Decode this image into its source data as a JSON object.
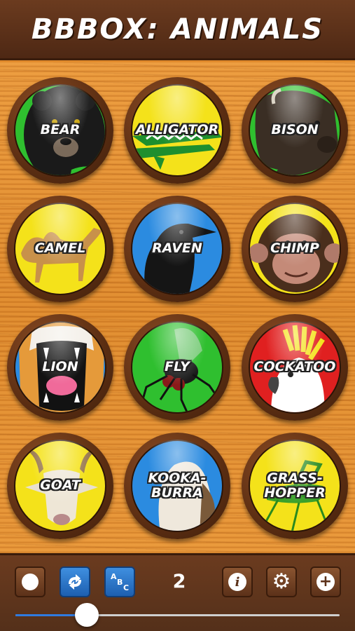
{
  "header": {
    "title": "BBBOX: ANIMALS"
  },
  "buttons": [
    {
      "id": "bear",
      "lines": [
        "BEAR"
      ],
      "bg": "#2fbf2f"
    },
    {
      "id": "alligator",
      "lines": [
        "ALLIGATOR"
      ],
      "bg": "#f4e21a"
    },
    {
      "id": "bison",
      "lines": [
        "BISON"
      ],
      "bg": "#2fbf2f"
    },
    {
      "id": "camel",
      "lines": [
        "CAMEL"
      ],
      "bg": "#f4e21a"
    },
    {
      "id": "raven",
      "lines": [
        "RAVEN"
      ],
      "bg": "#2b8be0"
    },
    {
      "id": "chimp",
      "lines": [
        "CHIMP"
      ],
      "bg": "#f4e21a"
    },
    {
      "id": "lion",
      "lines": [
        "LION"
      ],
      "bg": "#2b8be0"
    },
    {
      "id": "fly",
      "lines": [
        "FLY"
      ],
      "bg": "#2fbf2f"
    },
    {
      "id": "cockatoo",
      "lines": [
        "COCKATOO"
      ],
      "bg": "#e02020"
    },
    {
      "id": "goat",
      "lines": [
        "GOAT"
      ],
      "bg": "#f4e21a"
    },
    {
      "id": "kookaburra",
      "lines": [
        "KOOKA-",
        "BURRA"
      ],
      "bg": "#2b8be0"
    },
    {
      "id": "grasshopper",
      "lines": [
        "GRASS-",
        "HOPPER"
      ],
      "bg": "#f4e21a"
    }
  ],
  "toolbar": {
    "record_icon": "record-icon",
    "swap_icon": "swap-icon",
    "abc_icon": "abc-icon",
    "abc_text": [
      "A",
      "B",
      "C"
    ],
    "count": "2",
    "info_icon": "info-icon",
    "settings_icon": "gear-icon",
    "add_icon": "plus-icon"
  },
  "slider": {
    "value": 0.22,
    "fill_color": "#2f7be0"
  }
}
